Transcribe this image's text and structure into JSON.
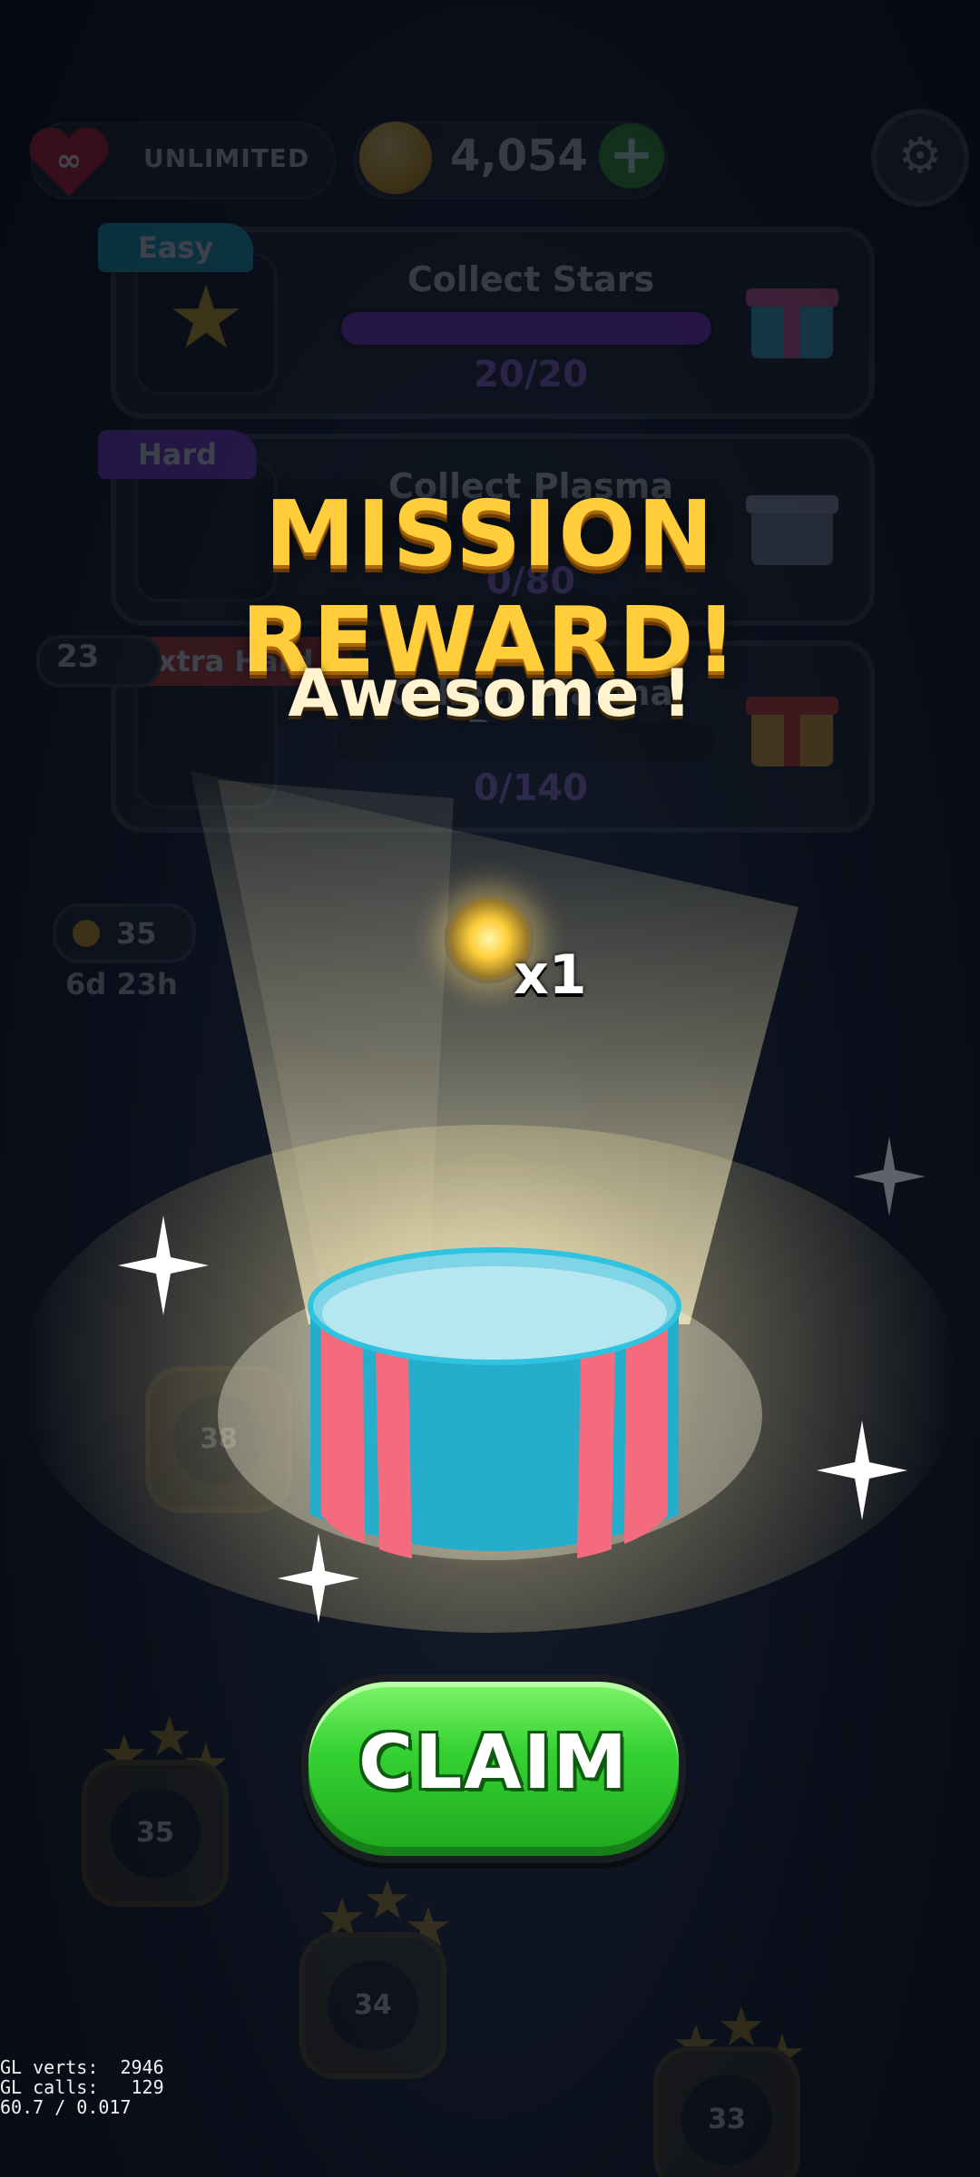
{
  "header": {
    "lives_label": "UNLIMITED",
    "coins": "4,054",
    "add_coins_symbol": "+",
    "settings_icon": "gear-icon"
  },
  "missions": [
    {
      "difficulty": "Easy",
      "title": "Collect Stars",
      "progress": "20/20",
      "progress_fraction": 1.0,
      "tag_color": "#1aa9c9",
      "reward_icon": "gift-icon"
    },
    {
      "difficulty": "Hard",
      "title": "Collect Plasma Beams",
      "progress": "0/80",
      "progress_fraction": 0.0,
      "tag_color": "#7a3bd6",
      "reward_icon": "gift-icon"
    },
    {
      "difficulty": "Extra Hard",
      "title": "Collect Plasma Beams",
      "progress": "0/140",
      "progress_fraction": 0.0,
      "tag_color": "#c43a2b",
      "reward_icon": "gift-icon"
    }
  ],
  "side_panel": {
    "level_badge": "23",
    "coin_cost": "35",
    "time_left": "6d 23h"
  },
  "map_levels": [
    "38",
    "35",
    "34",
    "33"
  ],
  "modal": {
    "title": "MISSION REWARD!",
    "subtitle": "Awesome !",
    "reward": {
      "icon": "plasma-orb-icon",
      "quantity": "x1"
    },
    "claim_label": "CLAIM",
    "colors": {
      "title": "#ffce3a",
      "claim": "#35d232",
      "box_blue": "#25aecb",
      "box_pink": "#f36b7c"
    }
  },
  "debug": {
    "line1": "GL verts:  2946",
    "line2": "GL calls:   129",
    "line3": "60.7 / 0.017"
  }
}
